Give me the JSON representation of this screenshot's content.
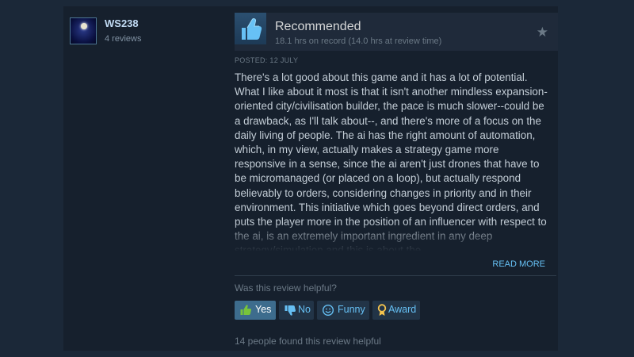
{
  "author": {
    "name": "WS238",
    "reviews_count": "4 reviews"
  },
  "review": {
    "verdict": "Recommended",
    "hours": "18.1 hrs on record (14.0 hrs at review time)",
    "posted": "POSTED: 12 JULY",
    "body": "There's a lot good about this game and it has a lot of potential. What I like about it most is that it isn't another mindless expansion-oriented city/civilisation builder, the pace is much slower--could be a drawback, as I'll talk about--, and there's more of a focus on the daily living of people. The ai has the right amount of automation, which, in my view, actually makes a strategy game more responsive in a sense, since the ai aren't just drones that have to be micromanaged (or placed on a loop), but actually respond believably to orders, considering changes in priority and in their environment. This initiative which goes beyond direct orders, and puts the player more in the position of an influencer with respect to the ai, is an extremely important ingredient in any deep strategy/simulation and this is about the",
    "read_more": "READ MORE"
  },
  "feedback": {
    "question": "Was this review helpful?",
    "yes_label": "Yes",
    "no_label": "No",
    "funny_label": "Funny",
    "award_label": "Award",
    "yes_selected": true,
    "found_helpful": "14 people found this review helpful"
  },
  "icons": {
    "thumb": "thumbs-up-icon",
    "favorite": "star-icon",
    "yes": "thumbs-up-icon",
    "no": "thumbs-down-icon",
    "funny": "smiley-icon",
    "award": "award-ribbon-icon"
  },
  "colors": {
    "page_bg": "#1b2838",
    "card_bg": "#16202d",
    "accent_link": "#66c0f4",
    "recommend_thumb": "#67c1f5",
    "award_gold": "#f5c44e",
    "yes_thumb": "#78c43b"
  }
}
